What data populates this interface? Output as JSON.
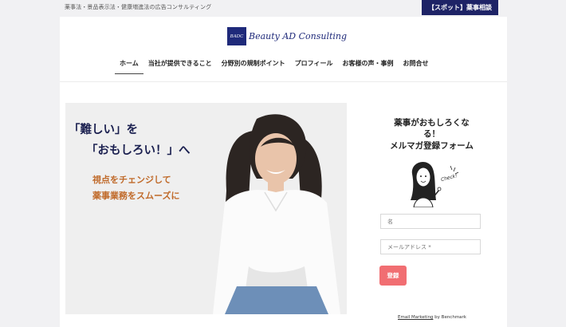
{
  "topbar": {
    "tagline": "薬事法・景品表示法・健康増進法の広告コンサルティング",
    "spot_button": "【スポット】薬事相談"
  },
  "logo": {
    "mark": "BADC",
    "text": "Beauty AD Consulting"
  },
  "nav": {
    "items": [
      {
        "label": "ホーム",
        "active": true
      },
      {
        "label": "当社が提供できること"
      },
      {
        "label": "分野別の規制ポイント"
      },
      {
        "label": "プロフィール"
      },
      {
        "label": "お客様の声・事例"
      },
      {
        "label": "お問合せ"
      }
    ]
  },
  "hero": {
    "line1": "「難しい」を",
    "line2": "「おもしろい！」へ",
    "line3": "視点をチェンジして",
    "line4": "薬事業務をスムーズに"
  },
  "signup": {
    "title_line1": "薬事がおもしろくな",
    "title_line2": "る！",
    "title_line3": "メルマガ登録フォーム",
    "illust_text": "Check!",
    "name_placeholder": "名",
    "email_placeholder": "メールアドレス *",
    "submit_label": "登録",
    "credit_link": "Email Marketing",
    "credit_suffix": " by Benchmark"
  },
  "colors": {
    "navy": "#1e2366",
    "submit": "#f16e72",
    "hero_accent": "#c06a2a"
  }
}
